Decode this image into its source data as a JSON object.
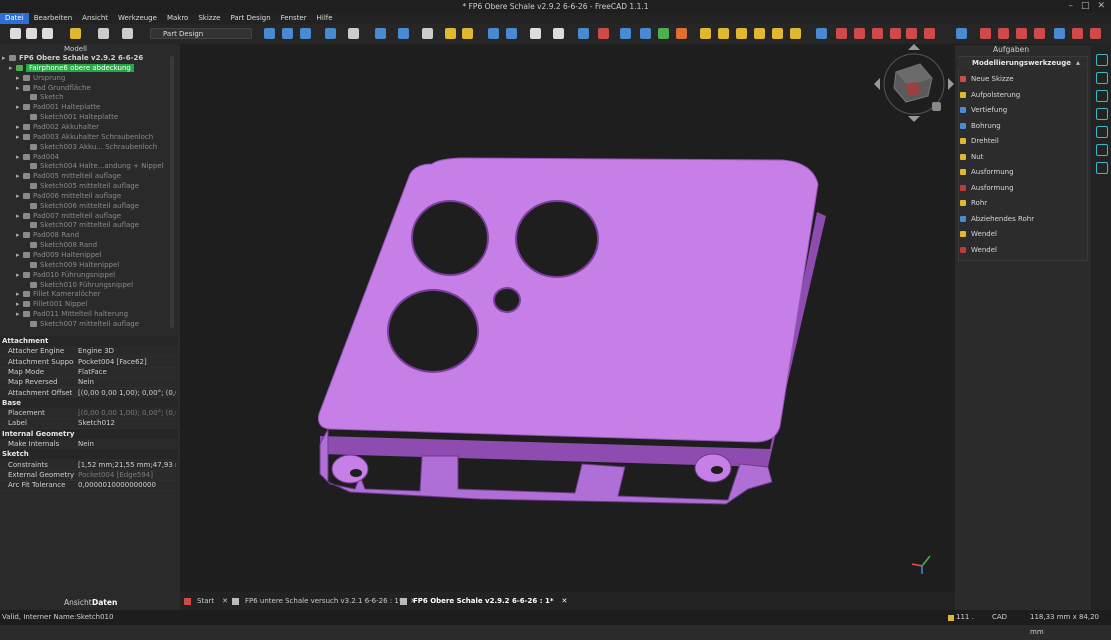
{
  "window": {
    "title": "* FP6 Obere Schale v2.9.2 6-6-26 - FreeCAD 1.1.1"
  },
  "menu": [
    "Datei",
    "Bearbeiten",
    "Ansicht",
    "Werkzeuge",
    "Makro",
    "Skizze",
    "Part Design",
    "Fenster",
    "Hilfe"
  ],
  "toolbar": {
    "workbench": "Part Design"
  },
  "panels": {
    "model": "Modell",
    "tasks": "Aufgaben",
    "view_tab": "Ansicht",
    "data_tab": "Daten"
  },
  "tree": [
    {
      "label": "FP6 Obere Schale v2.9.2 6-6-26",
      "level": 0,
      "style": "bold"
    },
    {
      "label": "Fairphone6 obere abdeckung",
      "level": 1,
      "style": "hl"
    },
    {
      "label": "Ursprung",
      "level": 2,
      "style": "dim"
    },
    {
      "label": "Pad Grundfläche",
      "level": 2,
      "style": "dim"
    },
    {
      "label": "Sketch",
      "level": 3,
      "style": "dim"
    },
    {
      "label": "Pad001 Halteplatte",
      "level": 2,
      "style": "dim"
    },
    {
      "label": "Sketch001 Halteplatte",
      "level": 3,
      "style": "dim"
    },
    {
      "label": "Pad002 Akkuhalter",
      "level": 2,
      "style": "dim"
    },
    {
      "label": "Pad003 Akkuhalter Schraubenloch",
      "level": 2,
      "style": "dim"
    },
    {
      "label": "Sketch003 Akku... Schraubenloch",
      "level": 3,
      "style": "dim"
    },
    {
      "label": "Pad004",
      "level": 2,
      "style": "dim"
    },
    {
      "label": "Sketch004 Halte...andung + Nippel",
      "level": 3,
      "style": "dim"
    },
    {
      "label": "Pad005 mittelteil auflage",
      "level": 2,
      "style": "dim"
    },
    {
      "label": "Sketch005 mittelteil auflage",
      "level": 3,
      "style": "dim"
    },
    {
      "label": "Pad006 mittelteil auflage",
      "level": 2,
      "style": "dim"
    },
    {
      "label": "Sketch006 mittelteil auflage",
      "level": 3,
      "style": "dim"
    },
    {
      "label": "Pad007 mittelteil auflage",
      "level": 2,
      "style": "dim"
    },
    {
      "label": "Sketch007 mittelteil auflage",
      "level": 3,
      "style": "dim"
    },
    {
      "label": "Pad008 Rand",
      "level": 2,
      "style": "dim"
    },
    {
      "label": "Sketch008 Rand",
      "level": 3,
      "style": "dim"
    },
    {
      "label": "Pad009 Haltenippel",
      "level": 2,
      "style": "dim"
    },
    {
      "label": "Sketch009 Haltenippel",
      "level": 3,
      "style": "dim"
    },
    {
      "label": "Pad010 Führungsnippel",
      "level": 2,
      "style": "dim"
    },
    {
      "label": "Sketch010 Führungsnippel",
      "level": 3,
      "style": "dim"
    },
    {
      "label": "Fillet Kameralöcher",
      "level": 2,
      "style": "dim"
    },
    {
      "label": "Fillet001 Nippel",
      "level": 2,
      "style": "dim"
    },
    {
      "label": "Pad011 Mittelteil halterung",
      "level": 2,
      "style": "dim"
    },
    {
      "label": "Sketch007 mittelteil auflage",
      "level": 3,
      "style": "dim"
    }
  ],
  "properties": [
    {
      "section": "Attachment"
    },
    {
      "key": "Attacher Engine",
      "value": "Engine 3D"
    },
    {
      "key": "Attachment Support",
      "value": "Pocket004 [Face62]"
    },
    {
      "key": "Map Mode",
      "value": "FlatFace"
    },
    {
      "key": "Map Reversed",
      "value": "Nein"
    },
    {
      "key": "Attachment Offset",
      "value": "[(0,00 0,00 1,00); 0,00°; (0,00 ..."
    },
    {
      "section": "Base"
    },
    {
      "key": "Placement",
      "value": "[(0,00 0,00 1,00); 0,00°; (0,00 ...",
      "dim": true
    },
    {
      "key": "Label",
      "value": "Sketch012"
    },
    {
      "section": "Internal Geometry"
    },
    {
      "key": "Make Internals",
      "value": "Nein"
    },
    {
      "section": "Sketch"
    },
    {
      "key": "Constraints",
      "value": "[1,52 mm;21,55 mm;47,93 m..."
    },
    {
      "key": "External Geometry",
      "value": "Pocket004 [Edge594]",
      "dim": true
    },
    {
      "key": "Arc Fit Tolerance",
      "value": "0,0000010000000000"
    }
  ],
  "tasks": {
    "header": "Modellierungswerkzeuge",
    "items": [
      {
        "label": "Neue Skizze",
        "color": "#d04a4a"
      },
      {
        "label": "Aufpolsterung",
        "color": "#e0b830"
      },
      {
        "label": "Vertiefung",
        "color": "#4a8ad0"
      },
      {
        "label": "Bohrung",
        "color": "#4a8ad0"
      },
      {
        "label": "Drehteil",
        "color": "#e0b830"
      },
      {
        "label": "Nut",
        "color": "#e0b830"
      },
      {
        "label": "Ausformung",
        "color": "#e0b830"
      },
      {
        "label": "Ausformung",
        "color": "#c03a3a"
      },
      {
        "label": "Rohr",
        "color": "#e0b830"
      },
      {
        "label": "Abziehendes Rohr",
        "color": "#4a8ad0"
      },
      {
        "label": "Wendel",
        "color": "#e0b830"
      },
      {
        "label": "Wendel",
        "color": "#c03a3a"
      }
    ]
  },
  "doc_tabs": [
    {
      "label": "Start",
      "active": false
    },
    {
      "label": "FP6 untere Schale versuch v3.2.1  6-6-26 : 1*",
      "active": false
    },
    {
      "label": "FP6 Obere Schale v2.9.2 6-6-26 : 1*",
      "active": true
    }
  ],
  "status": {
    "message": "Valid, Interner Name:Sketch010",
    "zoom": "111 .",
    "nav": "CAD",
    "dimensions": "118,33 mm x 84,20 mm"
  },
  "colors": {
    "part_fill": "#c77fe8",
    "part_edge": "#8e4cb0",
    "tree_highlight": "#28a745",
    "menu_active": "#2e6fd3"
  }
}
